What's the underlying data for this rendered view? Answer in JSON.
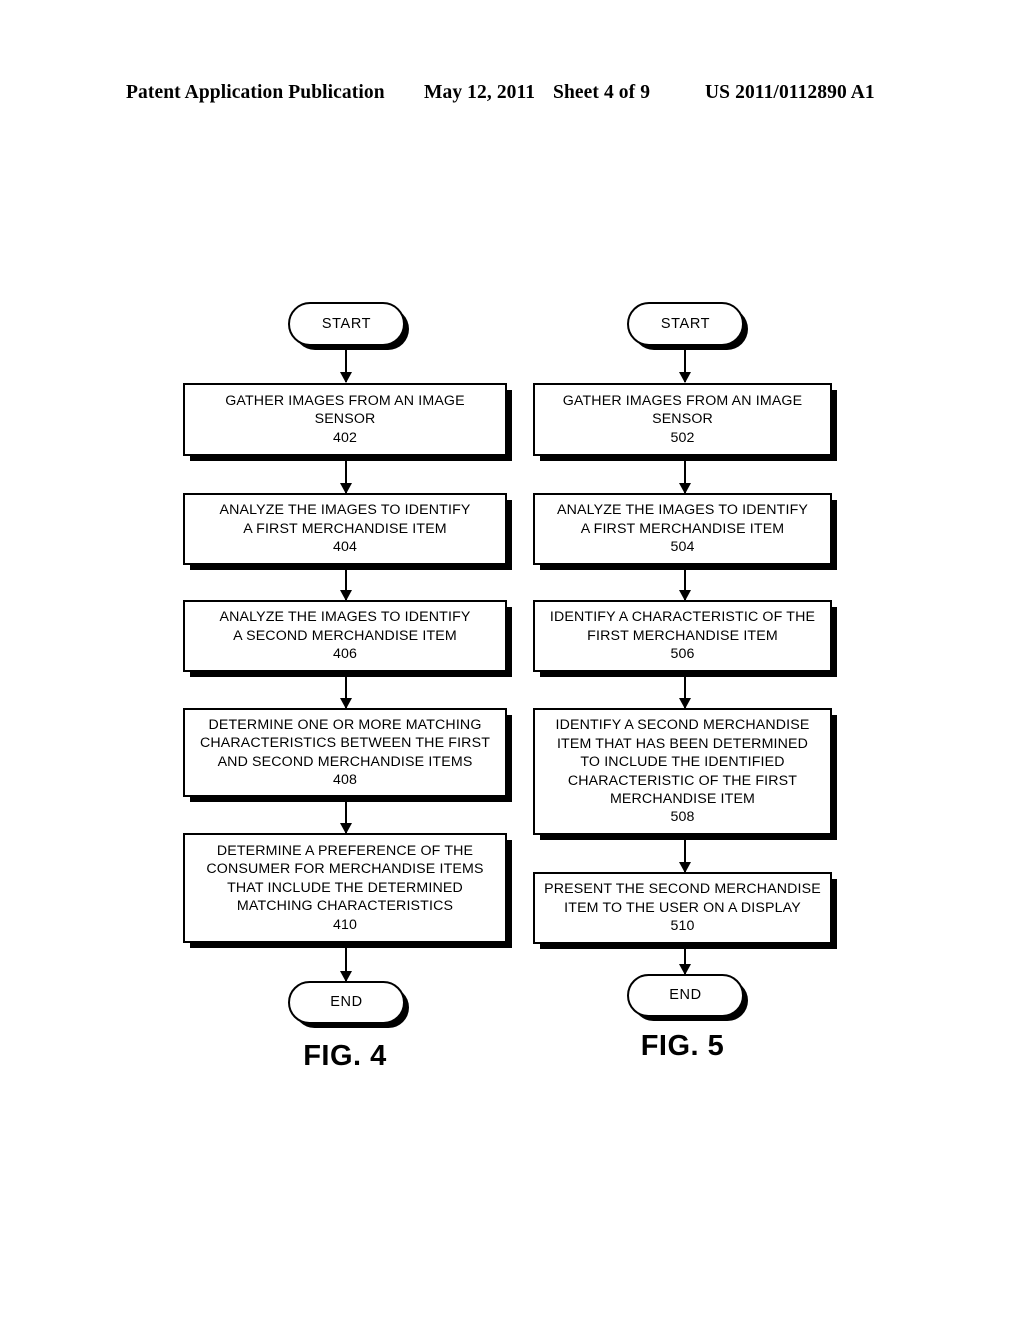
{
  "header": {
    "publication": "Patent Application Publication",
    "date": "May 12, 2011",
    "sheet": "Sheet 4 of 9",
    "patent_number": "US 2011/0112890 A1"
  },
  "figures": [
    {
      "caption": "FIG. 4",
      "start_label": "START",
      "end_label": "END",
      "steps": [
        {
          "lines": [
            "GATHER IMAGES FROM AN IMAGE",
            "SENSOR"
          ],
          "refnum": "402"
        },
        {
          "lines": [
            "ANALYZE THE IMAGES TO IDENTIFY",
            "A FIRST MERCHANDISE ITEM"
          ],
          "refnum": "404"
        },
        {
          "lines": [
            "ANALYZE THE IMAGES TO IDENTIFY",
            "A SECOND MERCHANDISE ITEM"
          ],
          "refnum": "406"
        },
        {
          "lines": [
            "DETERMINE ONE OR MORE MATCHING",
            "CHARACTERISTICS BETWEEN THE FIRST",
            "AND SECOND MERCHANDISE ITEMS"
          ],
          "refnum": "408"
        },
        {
          "lines": [
            "DETERMINE A PREFERENCE OF THE",
            "CONSUMER FOR MERCHANDISE ITEMS",
            "THAT INCLUDE THE DETERMINED",
            "MATCHING CHARACTERISTICS"
          ],
          "refnum": "410"
        }
      ]
    },
    {
      "caption": "FIG. 5",
      "start_label": "START",
      "end_label": "END",
      "steps": [
        {
          "lines": [
            "GATHER IMAGES FROM AN IMAGE",
            "SENSOR"
          ],
          "refnum": "502"
        },
        {
          "lines": [
            "ANALYZE THE IMAGES TO IDENTIFY",
            "A FIRST MERCHANDISE ITEM"
          ],
          "refnum": "504"
        },
        {
          "lines": [
            "IDENTIFY A CHARACTERISTIC OF THE",
            "FIRST MERCHANDISE ITEM"
          ],
          "refnum": "506"
        },
        {
          "lines": [
            "IDENTIFY A SECOND MERCHANDISE",
            "ITEM THAT HAS BEEN DETERMINED",
            "TO INCLUDE THE IDENTIFIED",
            "CHARACTERISTIC OF THE FIRST",
            "MERCHANDISE ITEM"
          ],
          "refnum": "508"
        },
        {
          "lines": [
            "PRESENT THE SECOND MERCHANDISE",
            "ITEM TO THE USER ON A DISPLAY"
          ],
          "refnum": "510"
        }
      ]
    }
  ],
  "colors": {
    "ink": "#000000",
    "paper": "#ffffff"
  }
}
